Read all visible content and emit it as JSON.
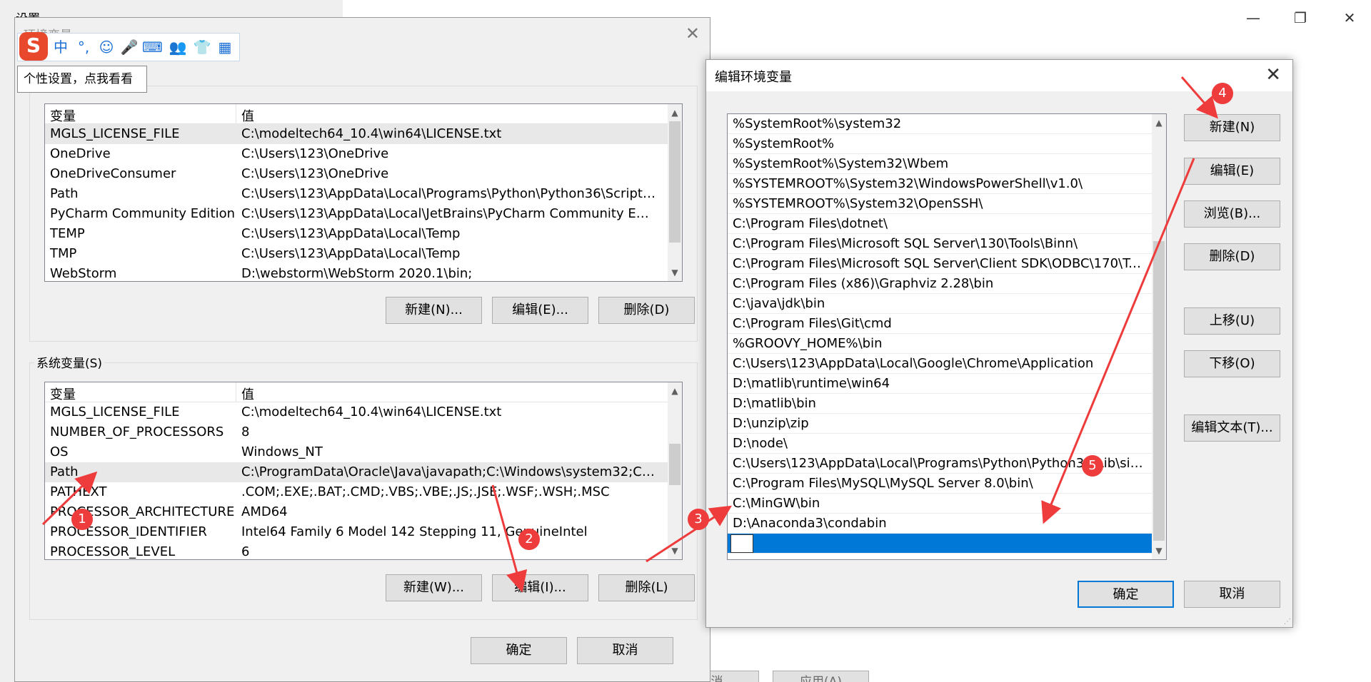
{
  "background": {
    "title": "设置",
    "footer_buttons": [
      "取消",
      "应用(A)"
    ]
  },
  "ime": {
    "logo": "S",
    "icons": [
      "中",
      "°,",
      "☺",
      "🎤",
      "⌨",
      "👥",
      "👕",
      "▦"
    ],
    "icon_names": [
      "chinese-mode-icon",
      "punctuation-icon",
      "emoji-icon",
      "microphone-icon",
      "keyboard-icon",
      "user-icon",
      "skin-icon",
      "toolbox-icon"
    ],
    "tooltip": "个性设置，点我看看"
  },
  "env_dialog": {
    "title": "环境变量",
    "user_vars": {
      "header": [
        "变量",
        "值"
      ],
      "rows": [
        [
          "MGLS_LICENSE_FILE",
          "C:\\modeltech64_10.4\\win64\\LICENSE.txt"
        ],
        [
          "OneDrive",
          "C:\\Users\\123\\OneDrive"
        ],
        [
          "OneDriveConsumer",
          "C:\\Users\\123\\OneDrive"
        ],
        [
          "Path",
          "C:\\Users\\123\\AppData\\Local\\Programs\\Python\\Python36\\Scripts\\;..."
        ],
        [
          "PyCharm Community Edition",
          "C:\\Users\\123\\AppData\\Local\\JetBrains\\PyCharm Community Editi..."
        ],
        [
          "TEMP",
          "C:\\Users\\123\\AppData\\Local\\Temp"
        ],
        [
          "TMP",
          "C:\\Users\\123\\AppData\\Local\\Temp"
        ],
        [
          "WebStorm",
          "D:\\webstorm\\WebStorm 2020.1\\bin;"
        ]
      ],
      "buttons": [
        "新建(N)...",
        "编辑(E)...",
        "删除(D)"
      ]
    },
    "system_vars": {
      "label": "系统变量(S)",
      "header": [
        "变量",
        "值"
      ],
      "rows": [
        [
          "MGLS_LICENSE_FILE",
          "C:\\modeltech64_10.4\\win64\\LICENSE.txt"
        ],
        [
          "NUMBER_OF_PROCESSORS",
          "8"
        ],
        [
          "OS",
          "Windows_NT"
        ],
        [
          "Path",
          "C:\\ProgramData\\Oracle\\Java\\javapath;C:\\Windows\\system32;C:\\Wi..."
        ],
        [
          "PATHEXT",
          ".COM;.EXE;.BAT;.CMD;.VBS;.VBE;.JS;.JSE;.WSF;.WSH;.MSC"
        ],
        [
          "PROCESSOR_ARCHITECTURE",
          "AMD64"
        ],
        [
          "PROCESSOR_IDENTIFIER",
          "Intel64 Family 6 Model 142 Stepping 11, GenuineIntel"
        ],
        [
          "PROCESSOR_LEVEL",
          "6"
        ]
      ],
      "buttons": [
        "新建(W)...",
        "编辑(I)...",
        "删除(L)"
      ]
    },
    "ok": "确定",
    "cancel": "取消"
  },
  "edit_dialog": {
    "title": "编辑环境变量",
    "paths": [
      "%SystemRoot%\\system32",
      "%SystemRoot%",
      "%SystemRoot%\\System32\\Wbem",
      "%SYSTEMROOT%\\System32\\WindowsPowerShell\\v1.0\\",
      "%SYSTEMROOT%\\System32\\OpenSSH\\",
      "C:\\Program Files\\dotnet\\",
      "C:\\Program Files\\Microsoft SQL Server\\130\\Tools\\Binn\\",
      "C:\\Program Files\\Microsoft SQL Server\\Client SDK\\ODBC\\170\\Too...",
      "C:\\Program Files (x86)\\Graphviz 2.28\\bin",
      "C:\\java\\jdk\\bin",
      "C:\\Program Files\\Git\\cmd",
      "%GROOVY_HOME%\\bin",
      "C:\\Users\\123\\AppData\\Local\\Google\\Chrome\\Application",
      "D:\\matlib\\runtime\\win64",
      "D:\\matlib\\bin",
      "D:\\unzip\\zip",
      "D:\\node\\",
      "C:\\Users\\123\\AppData\\Local\\Programs\\Python\\Python36\\Lib\\site...",
      "C:\\Program Files\\MySQL\\MySQL Server 8.0\\bin\\",
      "C:\\MinGW\\bin",
      "D:\\Anaconda3\\condabin"
    ],
    "editing_value": "",
    "buttons": {
      "new": "新建(N)",
      "edit": "编辑(E)",
      "browse": "浏览(B)...",
      "delete": "删除(D)",
      "move_up": "上移(U)",
      "move_down": "下移(O)",
      "edit_text": "编辑文本(T)..."
    },
    "ok": "确定",
    "cancel": "取消"
  },
  "annotations": {
    "color": "#ee3b3b",
    "badges": [
      "1",
      "2",
      "3",
      "4",
      "5"
    ]
  }
}
